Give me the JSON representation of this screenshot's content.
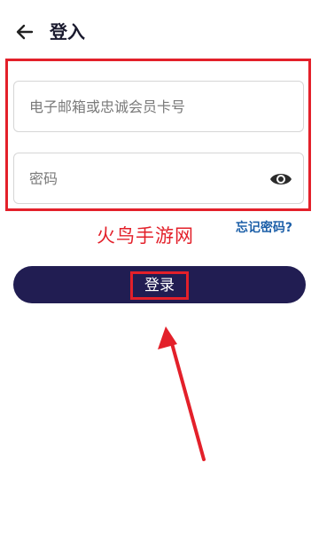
{
  "header": {
    "title": "登入",
    "back_icon": "back-arrow-icon"
  },
  "form": {
    "email_placeholder": "电子邮箱或忠诚会员卡号",
    "password_placeholder": "密码",
    "show_password_icon": "eye-icon",
    "forgot_password": "忘记密码?",
    "login_label": "登录"
  },
  "annotation": {
    "watermark": "火鸟手游网",
    "color": "#e3202a"
  },
  "colors": {
    "primary_button": "#211d52",
    "link": "#1c5fa8"
  }
}
